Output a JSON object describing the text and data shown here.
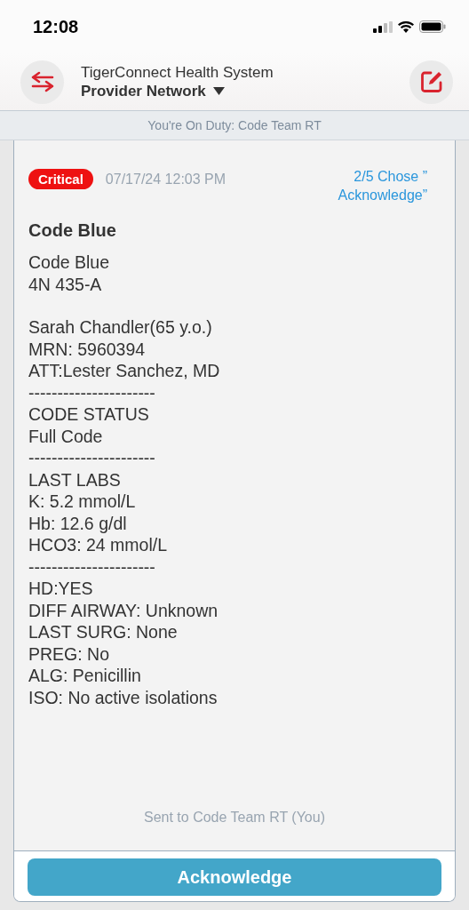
{
  "status_bar": {
    "time": "12:08"
  },
  "header": {
    "organization": "TigerConnect Health System",
    "network": "Provider Network"
  },
  "duty_banner": "You're On Duty: Code Team RT",
  "message": {
    "priority": "Critical",
    "timestamp": "07/17/24 12:03 PM",
    "response_count": "2/5 Chose ” Acknowledge”",
    "title": "Code Blue",
    "paragraphs": [
      {
        "lines": [
          "Code Blue",
          "4N 435-A"
        ]
      },
      {
        "lines": [
          "Sarah Chandler(65 y.o.)",
          "MRN: 5960394",
          "ATT:Lester Sanchez, MD",
          "----------------------",
          "CODE STATUS",
          "Full Code",
          "----------------------",
          "LAST LABS",
          "K: 5.2 mmol/L",
          "Hb: 12.6 g/dl",
          "HCO3: 24 mmol/L",
          "----------------------",
          "HD:YES",
          "DIFF AIRWAY: Unknown",
          "LAST SURG: None",
          "PREG: No",
          "ALG: Penicillin",
          "ISO: No active isolations"
        ]
      }
    ],
    "recipient": "Sent to Code Team RT (You)"
  },
  "action_button": "Acknowledge"
}
